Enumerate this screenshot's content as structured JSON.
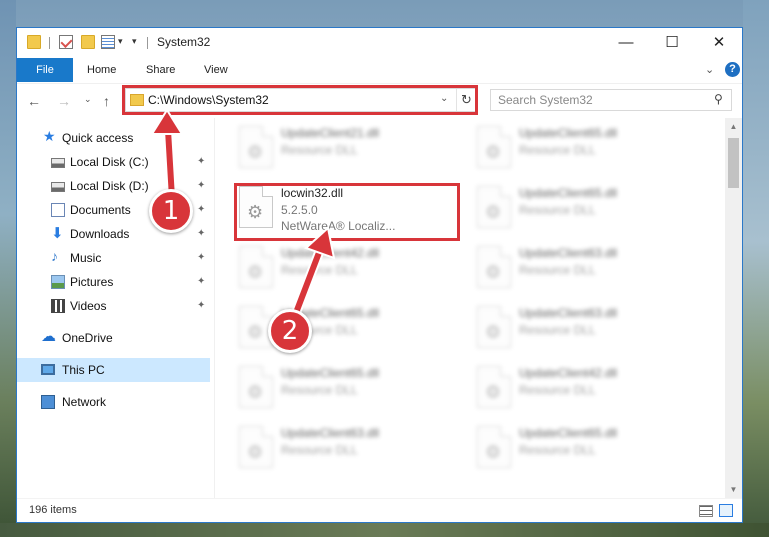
{
  "window": {
    "title": "System32",
    "controls": {
      "minimize": "—",
      "maximize": "☐",
      "close": "✕"
    }
  },
  "ribbon": {
    "file": "File",
    "tabs": [
      "Home",
      "Share",
      "View"
    ],
    "expand_glyph": "⌄",
    "help_glyph": "?"
  },
  "nav": {
    "back": "←",
    "forward": "→",
    "recent": "⌄",
    "up": "↑",
    "address": "C:\\Windows\\System32",
    "address_dropdown": "⌄",
    "refresh": "↻",
    "search_placeholder": "Search System32",
    "search_glyph": "⚲"
  },
  "sidebar": {
    "items": [
      {
        "label": "Quick access",
        "icon": "star-icon",
        "pinned": false
      },
      {
        "label": "Local Disk (C:)",
        "icon": "drive-icon",
        "pinned": true
      },
      {
        "label": "Local Disk (D:)",
        "icon": "drive-icon",
        "pinned": true
      },
      {
        "label": "Documents",
        "icon": "documents-icon",
        "pinned": true
      },
      {
        "label": "Downloads",
        "icon": "downloads-icon",
        "pinned": true
      },
      {
        "label": "Music",
        "icon": "music-icon",
        "pinned": true
      },
      {
        "label": "Pictures",
        "icon": "pictures-icon",
        "pinned": true
      },
      {
        "label": "Videos",
        "icon": "videos-icon",
        "pinned": true
      },
      {
        "label": "OneDrive",
        "icon": "cloud-icon",
        "pinned": false
      },
      {
        "label": "This PC",
        "icon": "pc-icon",
        "pinned": false,
        "selected": true
      },
      {
        "label": "Network",
        "icon": "network-icon",
        "pinned": false
      }
    ],
    "pin_glyph": "📌"
  },
  "files": {
    "left": [
      {
        "name": "UpdateClient21.dll",
        "type": "Resource DLL"
      },
      {
        "name": "locwin32.dll",
        "version": "5.2.5.0",
        "company": "NetWareA® Localiz...",
        "highlighted": true
      },
      {
        "name": "UpdateClient42.dll",
        "type": "Resource DLL"
      },
      {
        "name": "UpdateClient65.dll",
        "type": "Resource DLL"
      },
      {
        "name": "UpdateClient65.dll",
        "type": "Resource DLL"
      },
      {
        "name": "UpdateClient63.dll",
        "type": "Resource DLL"
      }
    ],
    "right": [
      {
        "name": "UpdateClient65.dll",
        "type": "Resource DLL"
      },
      {
        "name": "UpdateClient65.dll",
        "type": "Resource DLL"
      },
      {
        "name": "UpdateClient63.dll",
        "type": "Resource DLL"
      },
      {
        "name": "UpdateClient63.dll",
        "type": "Resource DLL"
      },
      {
        "name": "UpdateClient42.dll",
        "type": "Resource DLL"
      },
      {
        "name": "UpdateClient65.dll",
        "type": "Resource DLL"
      }
    ]
  },
  "status": {
    "item_count": "196 items"
  },
  "annotations": {
    "step1": "1",
    "step2": "2",
    "accent_color": "#d8353a"
  }
}
